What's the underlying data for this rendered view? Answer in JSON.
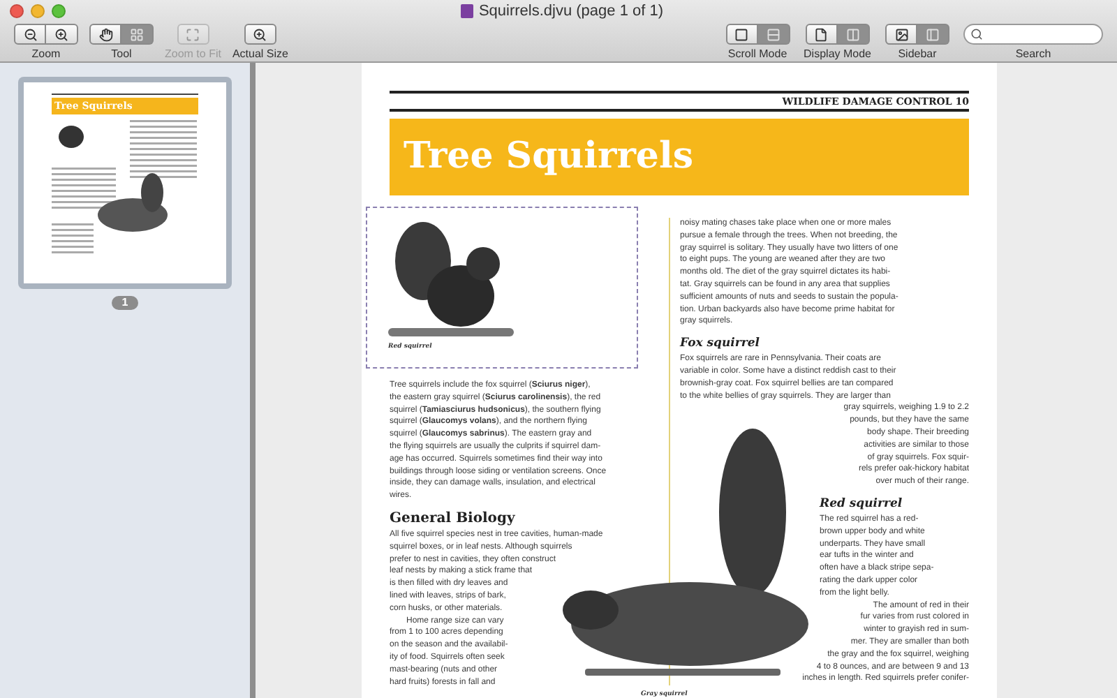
{
  "window": {
    "title": "Squirrels.djvu (page 1 of 1)"
  },
  "toolbar": {
    "left": [
      {
        "label": "Zoom",
        "disabled": false,
        "buttons": [
          {
            "selected": false
          },
          {
            "selected": false
          }
        ]
      },
      {
        "label": "Tool",
        "disabled": false,
        "buttons": [
          {
            "selected": false
          },
          {
            "selected": true
          }
        ]
      },
      {
        "label": "Zoom to Fit",
        "disabled": true,
        "buttons": [
          {
            "selected": false
          }
        ]
      },
      {
        "label": "Actual Size",
        "disabled": false,
        "buttons": [
          {
            "selected": false
          }
        ]
      }
    ],
    "right": [
      {
        "label": "Scroll Mode",
        "disabled": false,
        "buttons": [
          {
            "selected": false
          },
          {
            "selected": true
          }
        ]
      },
      {
        "label": "Display Mode",
        "disabled": false,
        "buttons": [
          {
            "selected": false
          },
          {
            "selected": true
          }
        ]
      },
      {
        "label": "Sidebar",
        "disabled": false,
        "buttons": [
          {
            "selected": false
          },
          {
            "selected": true
          }
        ]
      }
    ],
    "search_label": "Search"
  },
  "sidebar": {
    "thumbnail_title": "Tree Squirrels",
    "page_badge": "1",
    "selected": true
  },
  "document": {
    "header": "WILDLIFE DAMAGE CONTROL 10",
    "title": "Tree Squirrels",
    "figure_caption": "Red squirrel",
    "figure_caption_2": "Gray squirrel",
    "left_column": [
      {
        "kind": "paragraph",
        "lines": [
          "Tree squirrels include the fox squirrel (**Sciurus niger**),",
          "the eastern gray squirrel (**Sciurus carolinensis**), the red",
          "squirrel (**Tamiasciurus hudsonicus**), the southern flying",
          "squirrel (**Glaucomys volans**), and the northern flying",
          "squirrel (**Glaucomys sabrinus**). The eastern gray and",
          "the flying squirrels are usually the culprits if squirrel dam-",
          "age has occurred. Squirrels sometimes find their way into",
          "buildings through loose siding or ventilation screens. Once",
          "inside, they can damage walls, insulation, and electrical",
          "wires."
        ]
      },
      {
        "kind": "heading",
        "text": "General Biology"
      },
      {
        "kind": "paragraph",
        "lines": [
          "All five squirrel species nest in tree cavities, human-made",
          "squirrel boxes, or in leaf nests. Although squirrels",
          "prefer to nest in cavities, they often construct",
          "leaf nests by making a stick frame that",
          "is then filled with dry leaves and",
          "lined with leaves, strips of bark,",
          "corn husks, or other materials."
        ]
      },
      {
        "kind": "indented",
        "lines": [
          "Home range size can vary",
          "from 1 to 100 acres depending",
          "on the season and the availabil-",
          "ity of food. Squirrels often seek",
          "mast-bearing (nuts and other",
          "hard fruits) forests in fall and"
        ]
      }
    ],
    "right_column": [
      {
        "kind": "paragraph",
        "lines": [
          "noisy mating chases take place when one or more males",
          "pursue a female through the trees. When not breeding, the",
          "gray squirrel is solitary. They usually have two litters of one",
          "to eight pups. The young are weaned after they are two",
          "months old. The diet of the gray squirrel dictates its habi-",
          "tat. Gray squirrels can be found in any area that supplies",
          "sufficient amounts of nuts and seeds to sustain the popula-",
          "tion. Urban backyards also have become prime habitat for",
          "gray squirrels."
        ]
      },
      {
        "kind": "subheading",
        "text": "Fox squirrel"
      },
      {
        "kind": "wrap",
        "lines": [
          "Fox squirrels are rare in Pennsylvania. Their coats are",
          "variable in color. Some have a distinct reddish cast to their",
          "brownish-gray coat. Fox squirrel bellies are tan compared",
          "to the white bellies of gray squirrels. They are larger than",
          "gray squirrels, weighing 1.9 to 2.2",
          "pounds, but they have the same",
          "body shape. Their breeding",
          "activities are similar to those",
          "of gray squirrels. Fox squir-",
          "rels prefer oak-hickory habitat",
          "over much of their range."
        ]
      },
      {
        "kind": "subheading",
        "text": "Red squirrel"
      },
      {
        "kind": "narrow",
        "lines": [
          "The red squirrel has a red-",
          "brown upper body and white",
          "underparts. They have small",
          "ear tufts in the winter and",
          "often have a black stripe sepa-",
          "rating the dark upper color",
          "from the light belly."
        ]
      },
      {
        "kind": "wrap",
        "lines": [
          "The amount of red in their",
          "fur varies from rust colored in",
          "winter to grayish red in sum-",
          "mer. They are smaller than both",
          "the gray and the fox squirrel, weighing",
          "4 to 8 ounces, and are between 9 and 13",
          "inches in length. Red squirrels prefer conifer-"
        ]
      }
    ]
  }
}
